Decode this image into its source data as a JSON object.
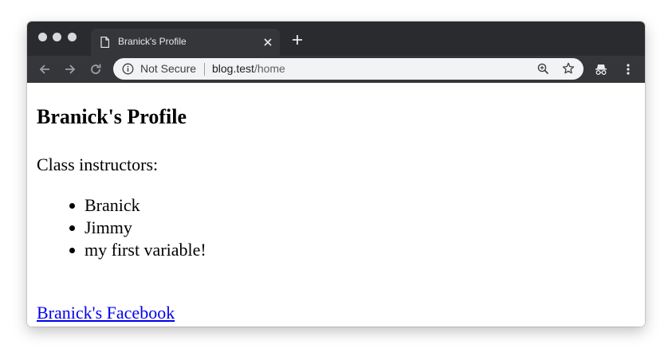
{
  "browser": {
    "tab": {
      "title": "Branick's Profile"
    },
    "omnibox": {
      "security_label": "Not Secure",
      "url_host": "blog.test",
      "url_path": "/home"
    }
  },
  "page": {
    "heading": "Branick's Profile",
    "instructors_label": "Class instructors:",
    "instructors": [
      "Branick",
      "Jimmy",
      "my first variable!"
    ],
    "facebook_link": "Branick's Facebook"
  },
  "colors": {
    "titlebar": "#292b2e",
    "toolbar": "#35363a",
    "omnibox": "#f1f3f4",
    "link": "#0000ee"
  },
  "icons": [
    "page-icon",
    "close-icon",
    "plus-icon",
    "back-arrow-icon",
    "forward-arrow-icon",
    "reload-icon",
    "info-icon",
    "zoom-icon",
    "star-icon",
    "incognito-icon",
    "more-vert-icon"
  ]
}
